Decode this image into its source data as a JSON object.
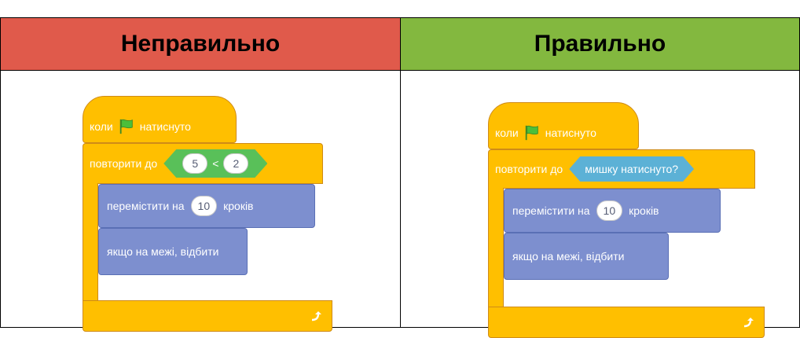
{
  "header": {
    "wrong_label": "Неправильно",
    "right_label": "Правильно"
  },
  "colors": {
    "wrong_header": "#e05a4b",
    "right_header": "#83b83f",
    "events_yellow": "#ffbf00",
    "motion_blue": "#7d8fcf",
    "operator_green": "#59c059",
    "sensing_blue": "#5cb1d6"
  },
  "wrong": {
    "hat": {
      "prefix": "коли",
      "icon": "green-flag-icon",
      "suffix": "натиснуто"
    },
    "repeat": {
      "label": "повторити до",
      "left": "5",
      "op": "<",
      "right": "2"
    },
    "move": {
      "label": "перемістити на",
      "value": "10",
      "unit": "кроків"
    },
    "bounce": {
      "label": "якщо на межі, відбити"
    }
  },
  "right": {
    "hat": {
      "prefix": "коли",
      "icon": "green-flag-icon",
      "suffix": "натиснуто"
    },
    "repeat": {
      "label": "повторити до",
      "condition": "мишку натиснуто?"
    },
    "move": {
      "label": "перемістити на",
      "value": "10",
      "unit": "кроків"
    },
    "bounce": {
      "label": "якщо на межі, відбити"
    }
  }
}
